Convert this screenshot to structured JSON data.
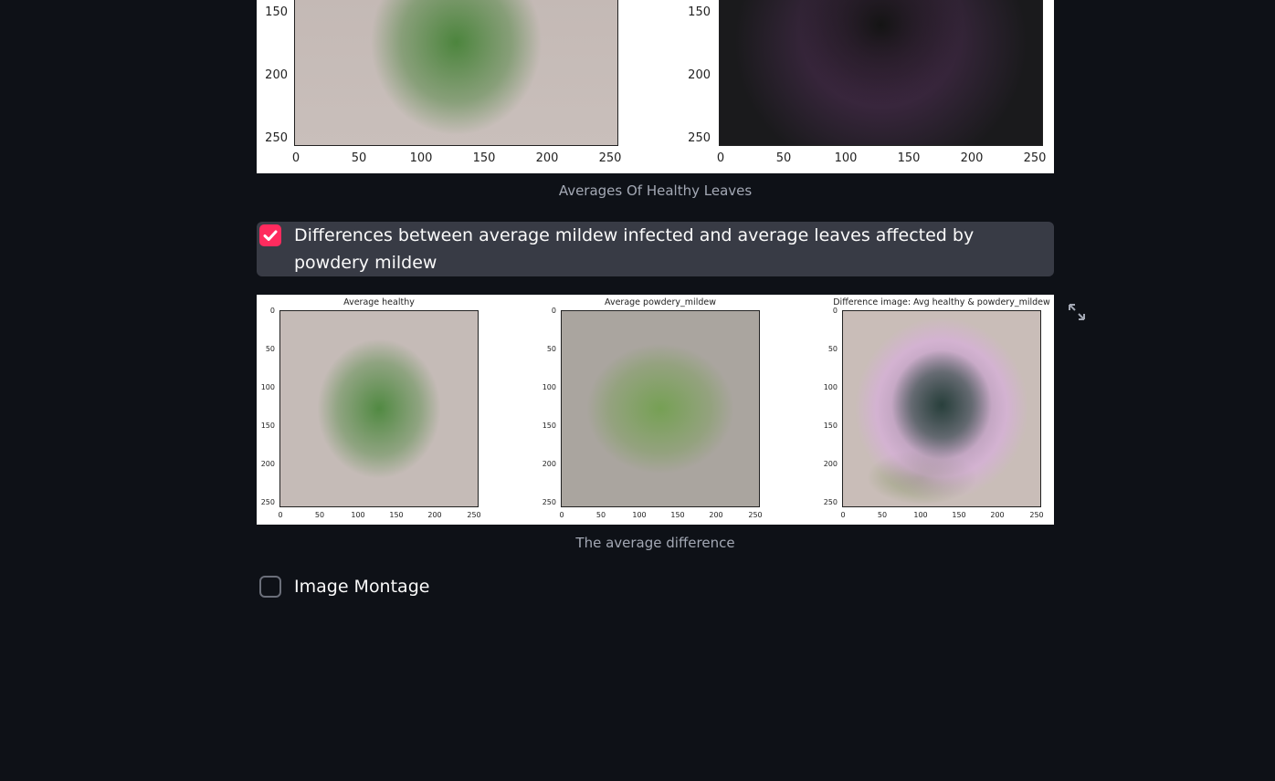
{
  "top_figure": {
    "y_ticks": [
      "150",
      "200",
      "250"
    ],
    "x_ticks": [
      "0",
      "50",
      "100",
      "150",
      "200",
      "250"
    ],
    "left_plot": {
      "icon": "green-average-leaf-image"
    },
    "right_plot": {
      "icon": "purple-variability-leaf-image"
    }
  },
  "top_caption": "Averages Of Healthy Leaves",
  "checkbox_diff": {
    "label": "Differences between average mildew infected and average leaves affected by powdery mildew",
    "checked": true,
    "accent": "#ff2b5e"
  },
  "bottom_figure": {
    "subplots": [
      {
        "title": "Average healthy"
      },
      {
        "title": "Average powdery_mildew"
      },
      {
        "title": "Difference image: Avg healthy & powdery_mildew"
      }
    ],
    "y_ticks": [
      "0",
      "50",
      "100",
      "150",
      "200",
      "250"
    ],
    "x_ticks": [
      "0",
      "50",
      "100",
      "150",
      "200",
      "250"
    ],
    "expand_icon": "fullscreen-expand-icon"
  },
  "bottom_caption": "The average difference",
  "checkbox_montage": {
    "label": "Image Montage",
    "checked": false
  },
  "colors": {
    "background": "#0e1117",
    "checkbox_accent": "#ff2b5e",
    "row_highlight": "#383b45",
    "caption_text": "#a3a8b4"
  }
}
